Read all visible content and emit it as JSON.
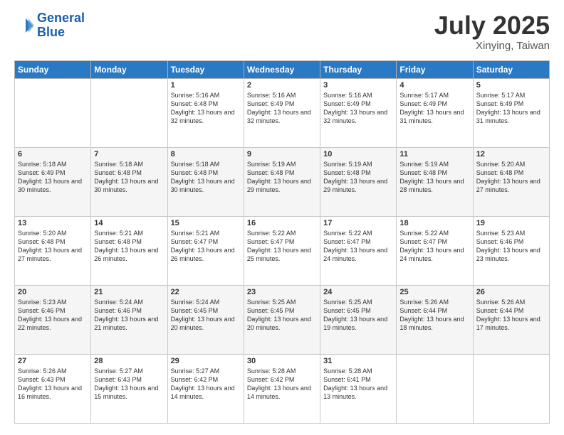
{
  "header": {
    "logo_line1": "General",
    "logo_line2": "Blue",
    "month": "July 2025",
    "location": "Xinying, Taiwan"
  },
  "days_of_week": [
    "Sunday",
    "Monday",
    "Tuesday",
    "Wednesday",
    "Thursday",
    "Friday",
    "Saturday"
  ],
  "weeks": [
    [
      {
        "day": "",
        "detail": ""
      },
      {
        "day": "",
        "detail": ""
      },
      {
        "day": "1",
        "detail": "Sunrise: 5:16 AM\nSunset: 6:48 PM\nDaylight: 13 hours and 32 minutes."
      },
      {
        "day": "2",
        "detail": "Sunrise: 5:16 AM\nSunset: 6:49 PM\nDaylight: 13 hours and 32 minutes."
      },
      {
        "day": "3",
        "detail": "Sunrise: 5:16 AM\nSunset: 6:49 PM\nDaylight: 13 hours and 32 minutes."
      },
      {
        "day": "4",
        "detail": "Sunrise: 5:17 AM\nSunset: 6:49 PM\nDaylight: 13 hours and 31 minutes."
      },
      {
        "day": "5",
        "detail": "Sunrise: 5:17 AM\nSunset: 6:49 PM\nDaylight: 13 hours and 31 minutes."
      }
    ],
    [
      {
        "day": "6",
        "detail": "Sunrise: 5:18 AM\nSunset: 6:49 PM\nDaylight: 13 hours and 30 minutes."
      },
      {
        "day": "7",
        "detail": "Sunrise: 5:18 AM\nSunset: 6:48 PM\nDaylight: 13 hours and 30 minutes."
      },
      {
        "day": "8",
        "detail": "Sunrise: 5:18 AM\nSunset: 6:48 PM\nDaylight: 13 hours and 30 minutes."
      },
      {
        "day": "9",
        "detail": "Sunrise: 5:19 AM\nSunset: 6:48 PM\nDaylight: 13 hours and 29 minutes."
      },
      {
        "day": "10",
        "detail": "Sunrise: 5:19 AM\nSunset: 6:48 PM\nDaylight: 13 hours and 29 minutes."
      },
      {
        "day": "11",
        "detail": "Sunrise: 5:19 AM\nSunset: 6:48 PM\nDaylight: 13 hours and 28 minutes."
      },
      {
        "day": "12",
        "detail": "Sunrise: 5:20 AM\nSunset: 6:48 PM\nDaylight: 13 hours and 27 minutes."
      }
    ],
    [
      {
        "day": "13",
        "detail": "Sunrise: 5:20 AM\nSunset: 6:48 PM\nDaylight: 13 hours and 27 minutes."
      },
      {
        "day": "14",
        "detail": "Sunrise: 5:21 AM\nSunset: 6:48 PM\nDaylight: 13 hours and 26 minutes."
      },
      {
        "day": "15",
        "detail": "Sunrise: 5:21 AM\nSunset: 6:47 PM\nDaylight: 13 hours and 26 minutes."
      },
      {
        "day": "16",
        "detail": "Sunrise: 5:22 AM\nSunset: 6:47 PM\nDaylight: 13 hours and 25 minutes."
      },
      {
        "day": "17",
        "detail": "Sunrise: 5:22 AM\nSunset: 6:47 PM\nDaylight: 13 hours and 24 minutes."
      },
      {
        "day": "18",
        "detail": "Sunrise: 5:22 AM\nSunset: 6:47 PM\nDaylight: 13 hours and 24 minutes."
      },
      {
        "day": "19",
        "detail": "Sunrise: 5:23 AM\nSunset: 6:46 PM\nDaylight: 13 hours and 23 minutes."
      }
    ],
    [
      {
        "day": "20",
        "detail": "Sunrise: 5:23 AM\nSunset: 6:46 PM\nDaylight: 13 hours and 22 minutes."
      },
      {
        "day": "21",
        "detail": "Sunrise: 5:24 AM\nSunset: 6:46 PM\nDaylight: 13 hours and 21 minutes."
      },
      {
        "day": "22",
        "detail": "Sunrise: 5:24 AM\nSunset: 6:45 PM\nDaylight: 13 hours and 20 minutes."
      },
      {
        "day": "23",
        "detail": "Sunrise: 5:25 AM\nSunset: 6:45 PM\nDaylight: 13 hours and 20 minutes."
      },
      {
        "day": "24",
        "detail": "Sunrise: 5:25 AM\nSunset: 6:45 PM\nDaylight: 13 hours and 19 minutes."
      },
      {
        "day": "25",
        "detail": "Sunrise: 5:26 AM\nSunset: 6:44 PM\nDaylight: 13 hours and 18 minutes."
      },
      {
        "day": "26",
        "detail": "Sunrise: 5:26 AM\nSunset: 6:44 PM\nDaylight: 13 hours and 17 minutes."
      }
    ],
    [
      {
        "day": "27",
        "detail": "Sunrise: 5:26 AM\nSunset: 6:43 PM\nDaylight: 13 hours and 16 minutes."
      },
      {
        "day": "28",
        "detail": "Sunrise: 5:27 AM\nSunset: 6:43 PM\nDaylight: 13 hours and 15 minutes."
      },
      {
        "day": "29",
        "detail": "Sunrise: 5:27 AM\nSunset: 6:42 PM\nDaylight: 13 hours and 14 minutes."
      },
      {
        "day": "30",
        "detail": "Sunrise: 5:28 AM\nSunset: 6:42 PM\nDaylight: 13 hours and 14 minutes."
      },
      {
        "day": "31",
        "detail": "Sunrise: 5:28 AM\nSunset: 6:41 PM\nDaylight: 13 hours and 13 minutes."
      },
      {
        "day": "",
        "detail": ""
      },
      {
        "day": "",
        "detail": ""
      }
    ]
  ]
}
